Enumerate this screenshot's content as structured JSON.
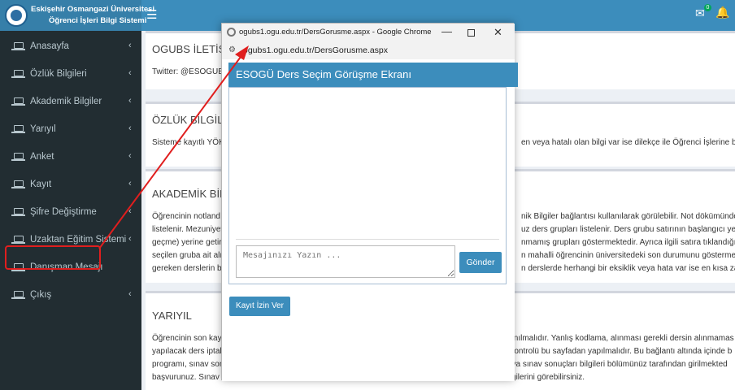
{
  "header": {
    "brand_line1": "Eskişehir Osmangazi Üniversitesi",
    "brand_line2": "Öğrenci İşleri Bilgi Sistemi",
    "menu_icon": "☰",
    "mail_icon": "✉",
    "mail_badge": "0",
    "bell_icon": "🔔"
  },
  "sidebar": {
    "items": [
      {
        "label": "Anasayfa",
        "chevron": "‹"
      },
      {
        "label": "Özlük Bilgileri",
        "chevron": "‹"
      },
      {
        "label": "Akademik Bilgiler",
        "chevron": "‹"
      },
      {
        "label": "Yarıyıl",
        "chevron": "‹"
      },
      {
        "label": "Anket",
        "chevron": "‹"
      },
      {
        "label": "Kayıt",
        "chevron": "‹"
      },
      {
        "label": "Şifre Değiştirme",
        "chevron": "‹"
      },
      {
        "label": "Uzaktan Eğitim Sistemi",
        "chevron": "‹"
      },
      {
        "label": "Danışman Mesajı",
        "chevron": ""
      },
      {
        "label": "Çıkış",
        "chevron": "‹"
      }
    ]
  },
  "content": {
    "b1_title": "OGUBS İLETİŞİM",
    "b1_text": "Twitter: @ESOGUBS",
    "b2_title": "ÖZLÜK BİLGİLERİ",
    "b2_text_l": "Sisteme kayıtlı YÖKSİS",
    "b2_text_r": "en veya hatalı olan bilgi var ise dilekçe ile Öğrenci İşlerine başvu",
    "b3_title": "AKADEMİK BİLGİLER",
    "b3_l": [
      "Öğrencinin notland",
      "listelenir. Mezuniyet",
      "geçme) yerine getiri",
      "seçilen gruba ait alı",
      "gereken derslerin be"
    ],
    "b3_r": [
      "nik Bilgiler bağlantısı kullanılarak görülebilir. Not dökümünde a",
      "uz ders grupları listelenir. Ders grubu satırının başlangıcı yeşil r",
      "nmamış grupları göstermektedir. Ayrıca ilgili satıra tıklandığınc",
      "n mahalli öğrencinin üniversitedeki son durumunu göstermekted",
      "n derslerde herhangi bir eksiklik veya hata var ise en kısa zamar"
    ],
    "b4_title": "YARIYIL",
    "b4_l": [
      "Öğrencinin son kayı",
      "yapılacak ders iptal",
      "programı, sınav son",
      "başvurunuz. Sınav s"
    ],
    "b4_r": [
      "klanılmalıdır. Yanlış kodlama, alınması gerekli dersin alınmamas",
      "n kontrolü bu sayfadan yapılmalıdır. Bu bağlantı altında içinde b",
      "veya sınav sonuçları bilgileri bölümünüz tarafından girilmekted",
      "bilgilerini görebilirsiniz."
    ]
  },
  "chrome": {
    "title": "ogubs1.ogu.edu.tr/DersGorusme.aspx - Google Chrome",
    "url": "ogubs1.ogu.edu.tr/DersGorusme.aspx",
    "min": "—",
    "close": "✕",
    "info_icon": "⚙"
  },
  "popup": {
    "header": "ESOGÜ Ders Seçim Görüşme Ekranı",
    "message_placeholder": "Mesajınızı Yazın ...",
    "send_label": "Gönder",
    "register_label": "Kayıt İzin Ver"
  },
  "colors": {
    "primary": "#3c8dbc",
    "sidebar": "#222d32",
    "highlight": "#e01e1e"
  }
}
